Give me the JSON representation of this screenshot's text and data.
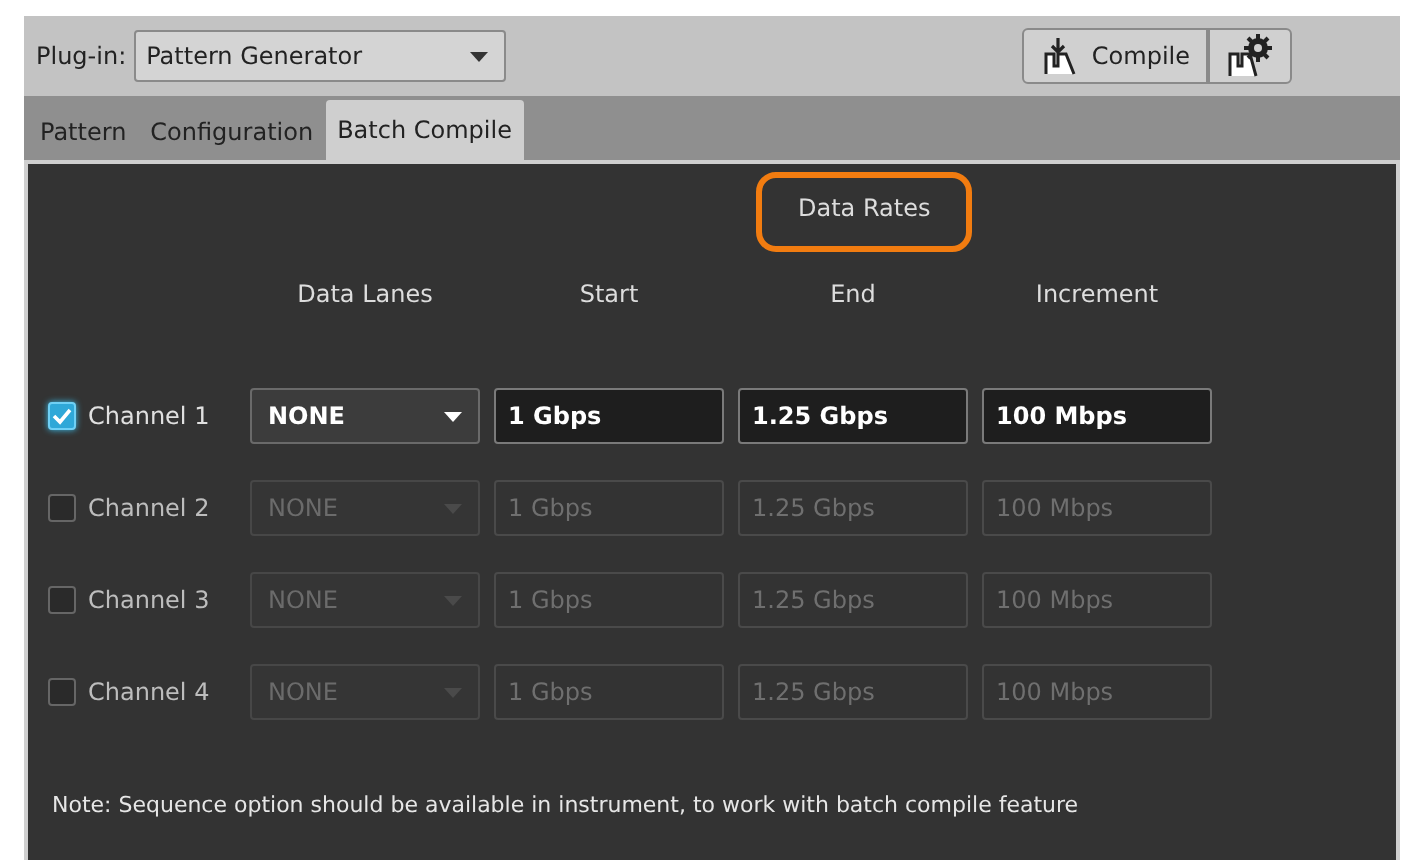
{
  "toolbar": {
    "plugin_label": "Plug-in:",
    "plugin_value": "Pattern Generator",
    "compile_button": "Compile"
  },
  "tabs": [
    {
      "label": "Pattern",
      "selected": false
    },
    {
      "label": "Configuration",
      "selected": false
    },
    {
      "label": "Batch Compile",
      "selected": true
    }
  ],
  "group_header": {
    "label": "Data Rates",
    "highlighted": true
  },
  "columns": [
    "Data Lanes",
    "Start",
    "End",
    "Increment"
  ],
  "channels": [
    {
      "name": "Channel 1",
      "checked": true,
      "data_lanes": "NONE",
      "start": "1 Gbps",
      "end": "1.25 Gbps",
      "increment": "100 Mbps"
    },
    {
      "name": "Channel 2",
      "checked": false,
      "data_lanes": "NONE",
      "start": "1 Gbps",
      "end": "1.25 Gbps",
      "increment": "100 Mbps"
    },
    {
      "name": "Channel 3",
      "checked": false,
      "data_lanes": "NONE",
      "start": "1 Gbps",
      "end": "1.25 Gbps",
      "increment": "100 Mbps"
    },
    {
      "name": "Channel 4",
      "checked": false,
      "data_lanes": "NONE",
      "start": "1 Gbps",
      "end": "1.25 Gbps",
      "increment": "100 Mbps"
    }
  ],
  "note": "Note: Sequence option should be available in instrument, to work with batch compile feature"
}
